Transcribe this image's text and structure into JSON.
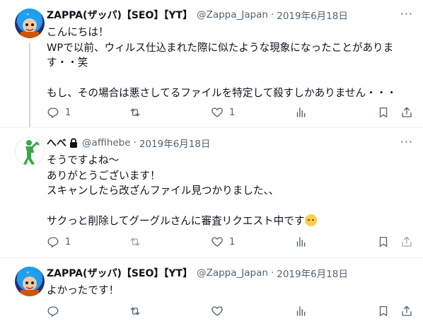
{
  "tweets": [
    {
      "author": {
        "name": "ZAPPA(ザッパ)【SEO】【YT】",
        "handle": "@Zappa_Japan",
        "date": "2019年6月18日",
        "avatar": "anime-character-avatar"
      },
      "body": [
        "こんにちは！",
        "WPで以前、ウィルス仕込まれた際に似たような現象になったことがありま",
        "す・・笑",
        "",
        "もし、その場合は悪さしてるファイルを特定して殺すしかありません・・・"
      ],
      "actions": {
        "reply_count": "1",
        "retweet_count": "",
        "like_count": "1"
      }
    },
    {
      "author": {
        "name": "へべ",
        "handle": "@affihebe",
        "date": "2019年6月18日",
        "avatar": "green-figure-avatar",
        "protected": true
      },
      "body": [
        "そうですよね〜",
        "ありがとうございます！",
        "スキャンしたら改ざんファイル見つかりました、、",
        "",
        "サクっと削除してグーグルさんに審査リクエスト中です"
      ],
      "emoji": "grinning-sweat-emoji",
      "actions": {
        "reply_count": "1",
        "retweet_count": "",
        "like_count": "1"
      }
    },
    {
      "author": {
        "name": "ZAPPA(ザッパ)【SEO】【YT】",
        "handle": "@Zappa_Japan",
        "date": "2019年6月18日",
        "avatar": "anime-character-avatar"
      },
      "body": [
        "よかったです！"
      ],
      "actions": {
        "reply_count": "",
        "retweet_count": "",
        "like_count": ""
      }
    }
  ],
  "ui": {
    "separator": "·",
    "more": "···"
  },
  "colors": {
    "text": "#0f1419",
    "muted": "#536471",
    "thread_line": "#cfd9de",
    "divider": "#eff3f4"
  }
}
